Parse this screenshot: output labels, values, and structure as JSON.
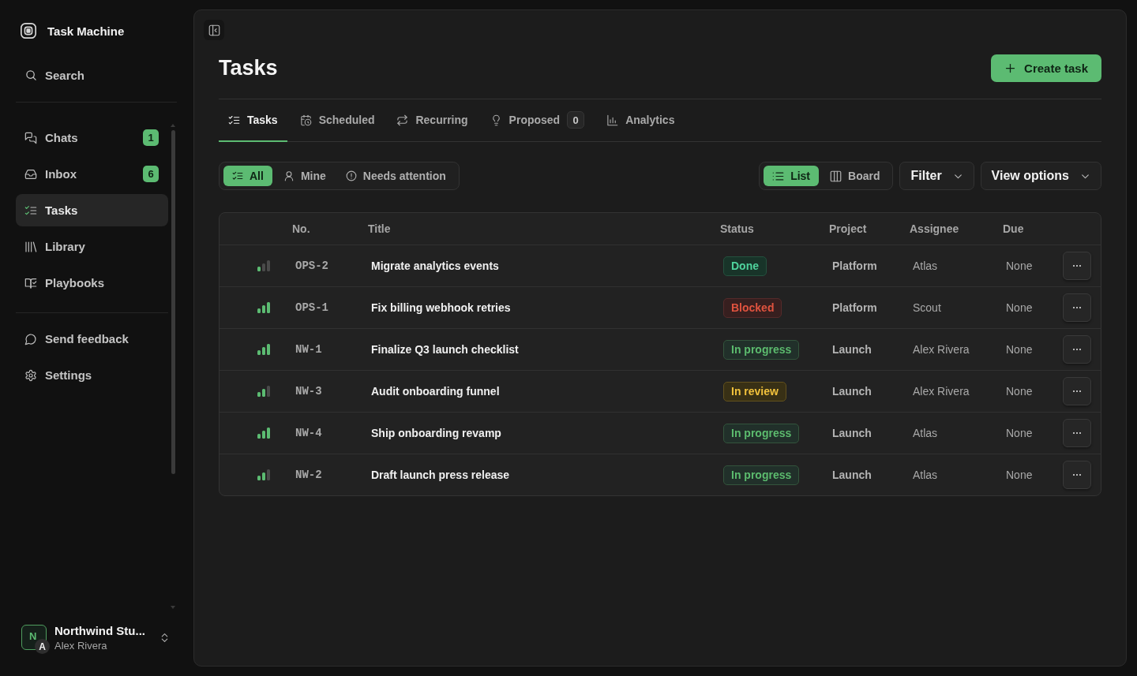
{
  "sidebar": {
    "app_name": "Task Machine",
    "search": "Search",
    "nav_items": [
      {
        "label": "Chats",
        "badge": "1",
        "selected": false
      },
      {
        "label": "Inbox",
        "badge": "6",
        "selected": false
      },
      {
        "label": "Tasks",
        "selected": true
      },
      {
        "label": "Library",
        "selected": false
      },
      {
        "label": "Playbooks",
        "selected": false
      }
    ],
    "footer_items": [
      {
        "label": "Send feedback"
      },
      {
        "label": "Settings"
      }
    ],
    "account": {
      "workspace_initial": "N",
      "user_initial": "A",
      "workspace_name": "Northwind Stu...",
      "user_name": "Alex Rivera"
    }
  },
  "page": {
    "title": "Tasks",
    "create_button": "Create task"
  },
  "tabs": [
    {
      "label": "Tasks",
      "selected": true
    },
    {
      "label": "Scheduled",
      "selected": false
    },
    {
      "label": "Recurring",
      "selected": false
    },
    {
      "label": "Proposed",
      "count": "0",
      "selected": false
    },
    {
      "label": "Analytics",
      "selected": false
    }
  ],
  "filters": [
    {
      "label": "All",
      "selected": true
    },
    {
      "label": "Mine",
      "selected": false
    },
    {
      "label": "Needs attention",
      "selected": false
    }
  ],
  "view_modes": [
    {
      "label": "List",
      "selected": true
    },
    {
      "label": "Board",
      "selected": false
    }
  ],
  "filter_button": "Filter",
  "view_options_button": "View options",
  "table": {
    "columns": [
      "No.",
      "Title",
      "Status",
      "Project",
      "Assignee",
      "Due"
    ],
    "rows": [
      {
        "priority": {
          "kind": "low"
        },
        "number": "OPS-2",
        "title": "Migrate analytics events",
        "status": {
          "label": "Done",
          "kind": "done"
        },
        "project": "Platform",
        "assignee": "Atlas",
        "due": "None"
      },
      {
        "priority": {
          "kind": "high"
        },
        "number": "OPS-1",
        "title": "Fix billing webhook retries",
        "status": {
          "label": "Blocked",
          "kind": "blocked"
        },
        "project": "Platform",
        "assignee": "Scout",
        "due": "None"
      },
      {
        "priority": {
          "kind": "high"
        },
        "number": "NW-1",
        "title": "Finalize Q3 launch checklist",
        "status": {
          "label": "In progress",
          "kind": "in_progress"
        },
        "project": "Launch",
        "assignee": "Alex Rivera",
        "due": "None"
      },
      {
        "priority": {
          "kind": "medium"
        },
        "number": "NW-3",
        "title": "Audit onboarding funnel",
        "status": {
          "label": "In review",
          "kind": "in_review"
        },
        "project": "Launch",
        "assignee": "Alex Rivera",
        "due": "None"
      },
      {
        "priority": {
          "kind": "high"
        },
        "number": "NW-4",
        "title": "Ship onboarding revamp",
        "status": {
          "label": "In progress",
          "kind": "in_progress"
        },
        "project": "Launch",
        "assignee": "Atlas",
        "due": "None"
      },
      {
        "priority": {
          "kind": "medium"
        },
        "number": "NW-2",
        "title": "Draft launch press release",
        "status": {
          "label": "In progress",
          "kind": "in_progress"
        },
        "project": "Launch",
        "assignee": "Atlas",
        "due": "None"
      }
    ]
  }
}
